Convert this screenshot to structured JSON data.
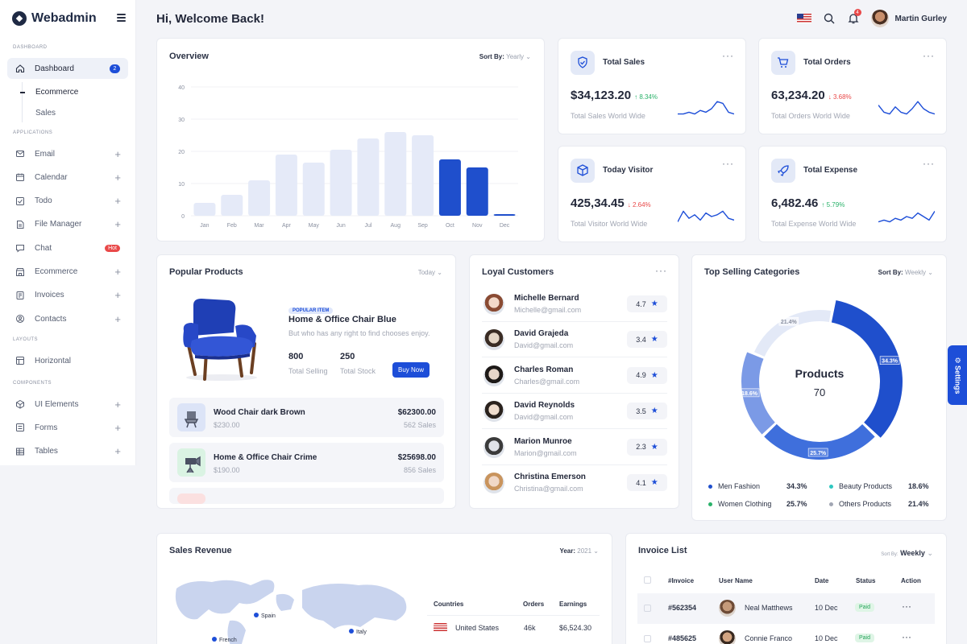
{
  "app": {
    "name": "Webadmin"
  },
  "sidebar": {
    "sections": {
      "dashboard": "DASHBOARD",
      "applications": "APPLICATIONS",
      "layouts": "LAYOUTS",
      "components": "COMPONENTS"
    },
    "dashboard": {
      "label": "Dashboard",
      "badge": "2"
    },
    "subitems": [
      "Ecommerce",
      "Sales"
    ],
    "apps": [
      {
        "label": "Email",
        "icon": "mail-icon"
      },
      {
        "label": "Calendar",
        "icon": "calendar-icon"
      },
      {
        "label": "Todo",
        "icon": "checkbox-icon"
      },
      {
        "label": "File Manager",
        "icon": "file-icon"
      },
      {
        "label": "Chat",
        "icon": "chat-icon",
        "tag": "Hot"
      },
      {
        "label": "Ecommerce",
        "icon": "store-icon"
      },
      {
        "label": "Invoices",
        "icon": "invoice-icon"
      },
      {
        "label": "Contacts",
        "icon": "contact-icon"
      }
    ],
    "layouts": [
      {
        "label": "Horizontal",
        "icon": "layout-icon"
      }
    ],
    "components": [
      {
        "label": "UI Elements",
        "icon": "box-icon"
      },
      {
        "label": "Forms",
        "icon": "form-icon"
      },
      {
        "label": "Tables",
        "icon": "table-icon"
      }
    ]
  },
  "header": {
    "welcome": "Hi, Welcome Back!",
    "user": "Martin Gurley",
    "notifications": "4"
  },
  "overview": {
    "title": "Overview",
    "sort_label": "Sort By:",
    "sort_value": "Yearly"
  },
  "chart_data": {
    "type": "bar",
    "title": "Overview",
    "categories": [
      "Jan",
      "Feb",
      "Mar",
      "Apr",
      "May",
      "Jun",
      "Jul",
      "Aug",
      "Sep",
      "Oct",
      "Nov",
      "Dec"
    ],
    "values": [
      4,
      6.5,
      11,
      19,
      16.5,
      20.5,
      24,
      26,
      25,
      17.5,
      15,
      0.5
    ],
    "highlighted": [
      "Oct",
      "Nov",
      "Dec"
    ],
    "yticks": [
      "0",
      "10",
      "20",
      "30",
      "40"
    ],
    "ylim": [
      0,
      40
    ],
    "colors": {
      "normal": "#e5eaf8",
      "highlight": "#1f4fcc"
    }
  },
  "stats": [
    {
      "title": "Total Sales",
      "value": "$34,123.20",
      "change": "8.34%",
      "dir": "up",
      "sub": "Total Sales World Wide",
      "icon": "shield-icon"
    },
    {
      "title": "Total Orders",
      "value": "63,234.20",
      "change": "3.68%",
      "dir": "down",
      "sub": "Total Orders World Wide",
      "icon": "cart-icon"
    },
    {
      "title": "Today Visitor",
      "value": "425,34.45",
      "change": "2.64%",
      "dir": "down",
      "sub": "Total Visitor World Wide",
      "icon": "cube-icon"
    },
    {
      "title": "Total Expense",
      "value": "6,482.46",
      "change": "5.79%",
      "dir": "up",
      "sub": "Total Expense World Wide",
      "icon": "rocket-icon"
    }
  ],
  "popular": {
    "title": "Popular Products",
    "filter": "Today",
    "featured": {
      "tag": "POPULAR ITEM",
      "name": "Home & Office Chair Blue",
      "desc": "But who has any right to find chooses enjoy.",
      "selling": "800",
      "selling_label": "Total Selling",
      "stock": "250",
      "stock_label": "Total Stock",
      "button": "Buy Now"
    },
    "items": [
      {
        "name": "Wood Chair dark Brown",
        "price": "$230.00",
        "amount": "$62300.00",
        "sales": "562 Sales"
      },
      {
        "name": "Home & Office Chair Crime",
        "price": "$190.00",
        "amount": "$25698.00",
        "sales": "856 Sales"
      }
    ]
  },
  "loyal": {
    "title": "Loyal Customers",
    "customers": [
      {
        "name": "Michelle Bernard",
        "email": "Michelle@gmail.com",
        "rating": "4.7"
      },
      {
        "name": "David Grajeda",
        "email": "David@gmail.com",
        "rating": "3.4"
      },
      {
        "name": "Charles Roman",
        "email": "Charles@gmail.com",
        "rating": "4.9"
      },
      {
        "name": "David Reynolds",
        "email": "David@gmail.com",
        "rating": "3.5"
      },
      {
        "name": "Marion Munroe",
        "email": "Marion@gmail.com",
        "rating": "2.3"
      },
      {
        "name": "Christina Emerson",
        "email": "Christina@gmail.com",
        "rating": "4.1"
      }
    ]
  },
  "categories": {
    "title": "Top Selling Categories",
    "sort_label": "Sort By:",
    "sort_value": "Weekly",
    "center_title": "Products",
    "center_value": "70",
    "slices": [
      {
        "name": "Men Fashion",
        "value": 34.3,
        "label": "34.3%",
        "color": "#1f4fcc"
      },
      {
        "name": "Beauty Products",
        "value": 25.7,
        "label": "25.7%",
        "color": "#3f6fdc"
      },
      {
        "name": "Women Clothing",
        "value": 18.6,
        "label": "18.6%",
        "color": "#7b9ae6"
      },
      {
        "name": "Others Products",
        "value": 21.4,
        "label": "21.4%",
        "color": "#e3e9f7"
      }
    ],
    "legend": [
      {
        "name": "Men Fashion",
        "pct": "34.3%",
        "color": "#1f4fcc"
      },
      {
        "name": "Beauty Products",
        "pct": "18.6%",
        "color": "#2ec7c0"
      },
      {
        "name": "Women Clothing",
        "pct": "25.7%",
        "color": "#2ab26a"
      },
      {
        "name": "Others Products",
        "pct": "21.4%",
        "color": "#a1a6b3"
      }
    ]
  },
  "revenue": {
    "title": "Sales Revenue",
    "year_label": "Year:",
    "year_value": "2021",
    "map_labels": [
      "Spain",
      "Italy",
      "French"
    ],
    "table": {
      "headers": [
        "Countries",
        "Orders",
        "Earnings"
      ],
      "rows": [
        {
          "country": "United States",
          "orders": "46k",
          "earnings": "$6,524.30"
        }
      ]
    }
  },
  "invoices": {
    "title": "Invoice List",
    "sort_label": "Sort By:",
    "sort_value": "Weekly",
    "headers": [
      "#Invoice",
      "User Name",
      "Date",
      "Status",
      "Action"
    ],
    "rows": [
      {
        "id": "#562354",
        "user": "Neal Matthews",
        "date": "10 Dec",
        "status": "Paid"
      },
      {
        "id": "#485625",
        "user": "Connie Franco",
        "date": "10 Dec",
        "status": "Paid"
      }
    ]
  },
  "settings": {
    "label": "Settings"
  }
}
